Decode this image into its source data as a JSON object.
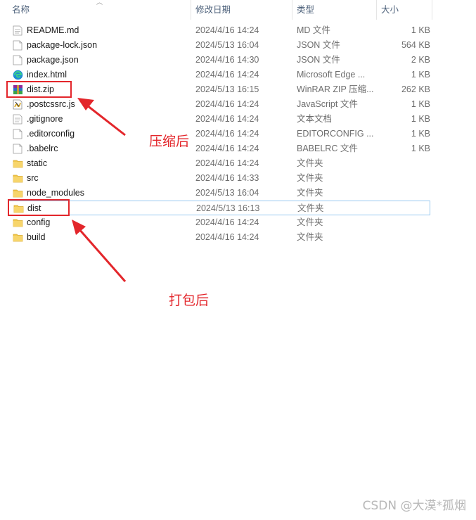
{
  "columns": {
    "name": "名称",
    "date": "修改日期",
    "type": "类型",
    "size": "大小"
  },
  "files": [
    {
      "icon": "text-file-icon",
      "name": "README.md",
      "date": "2024/4/16 14:24",
      "type": "MD 文件",
      "size": "1 KB"
    },
    {
      "icon": "json-file-icon",
      "name": "package-lock.json",
      "date": "2024/5/13 16:04",
      "type": "JSON 文件",
      "size": "564 KB"
    },
    {
      "icon": "json-file-icon",
      "name": "package.json",
      "date": "2024/4/16 14:30",
      "type": "JSON 文件",
      "size": "2 KB"
    },
    {
      "icon": "edge-html-icon",
      "name": "index.html",
      "date": "2024/4/16 14:24",
      "type": "Microsoft Edge ...",
      "size": "1 KB"
    },
    {
      "icon": "winrar-zip-icon",
      "name": "dist.zip",
      "date": "2024/5/13 16:15",
      "type": "WinRAR ZIP 压缩...",
      "size": "262 KB"
    },
    {
      "icon": "js-file-icon",
      "name": ".postcssrc.js",
      "date": "2024/4/16 14:24",
      "type": "JavaScript 文件",
      "size": "1 KB"
    },
    {
      "icon": "text-file-icon",
      "name": ".gitignore",
      "date": "2024/4/16 14:24",
      "type": "文本文档",
      "size": "1 KB"
    },
    {
      "icon": "blank-file-icon",
      "name": ".editorconfig",
      "date": "2024/4/16 14:24",
      "type": "EDITORCONFIG ...",
      "size": "1 KB"
    },
    {
      "icon": "blank-file-icon",
      "name": ".babelrc",
      "date": "2024/4/16 14:24",
      "type": "BABELRC 文件",
      "size": "1 KB"
    },
    {
      "icon": "folder-icon",
      "name": "static",
      "date": "2024/4/16 14:24",
      "type": "文件夹",
      "size": ""
    },
    {
      "icon": "folder-icon",
      "name": "src",
      "date": "2024/4/16 14:33",
      "type": "文件夹",
      "size": ""
    },
    {
      "icon": "folder-icon",
      "name": "node_modules",
      "date": "2024/5/13 16:04",
      "type": "文件夹",
      "size": ""
    },
    {
      "icon": "folder-icon",
      "name": "dist",
      "date": "2024/5/13 16:13",
      "type": "文件夹",
      "size": "",
      "selected": true
    },
    {
      "icon": "folder-icon",
      "name": "config",
      "date": "2024/4/16 14:24",
      "type": "文件夹",
      "size": ""
    },
    {
      "icon": "folder-icon",
      "name": "build",
      "date": "2024/4/16 14:24",
      "type": "文件夹",
      "size": ""
    }
  ],
  "annotations": {
    "after_compress": "压缩后",
    "after_build": "打包后",
    "color": "#e3262b"
  },
  "watermark": "CSDN @大漠*孤烟",
  "colors": {
    "folder": "#f2c94c",
    "selection_border": "#99c9f0",
    "header_text": "#4c607a"
  }
}
